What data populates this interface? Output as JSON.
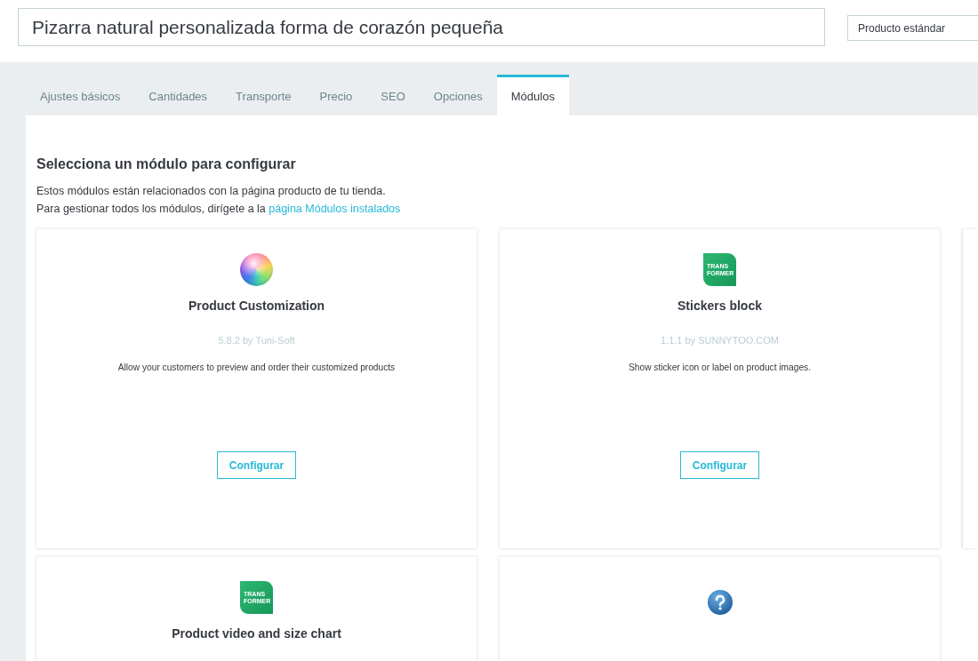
{
  "product": {
    "name_field": {
      "value": "Pizarra natural personalizada forma de corazón pequeña"
    },
    "type_select": {
      "value": "Producto estándar"
    }
  },
  "tabs": [
    {
      "label": "Ajustes básicos",
      "selected": false
    },
    {
      "label": "Cantidades",
      "selected": false
    },
    {
      "label": "Transporte",
      "selected": false
    },
    {
      "label": "Precio",
      "selected": false
    },
    {
      "label": "SEO",
      "selected": false
    },
    {
      "label": "Opciones",
      "selected": false
    },
    {
      "label": "Módulos",
      "selected": true
    }
  ],
  "section": {
    "heading": "Selecciona un módulo para configurar",
    "intro": "Estos módulos están relacionados con la página producto de tu tienda.",
    "link_prefix": "Para gestionar todos los módulos, dirígete a la",
    "link": "página Módulos instalados"
  },
  "modules": [
    {
      "kind": "sphere",
      "name": "Product Customization",
      "version": "5.8.2 by Tuni-Soft",
      "description": "Allow your customers to preview and order their customized products",
      "button": "Configurar"
    },
    {
      "kind": "tile",
      "logo_text": [
        "TRANS",
        "FORMER"
      ],
      "name": "Stickers block",
      "version": "1.1.1 by SUNNYTOO.COM",
      "description": "Show sticker icon or label on product images.",
      "button": "Configurar"
    },
    {
      "kind": "partial"
    },
    {
      "kind": "tile",
      "logo_text": [
        "TRANS",
        "FORMER"
      ],
      "name": "Product video and size chart"
    },
    {
      "kind": "help"
    }
  ]
}
